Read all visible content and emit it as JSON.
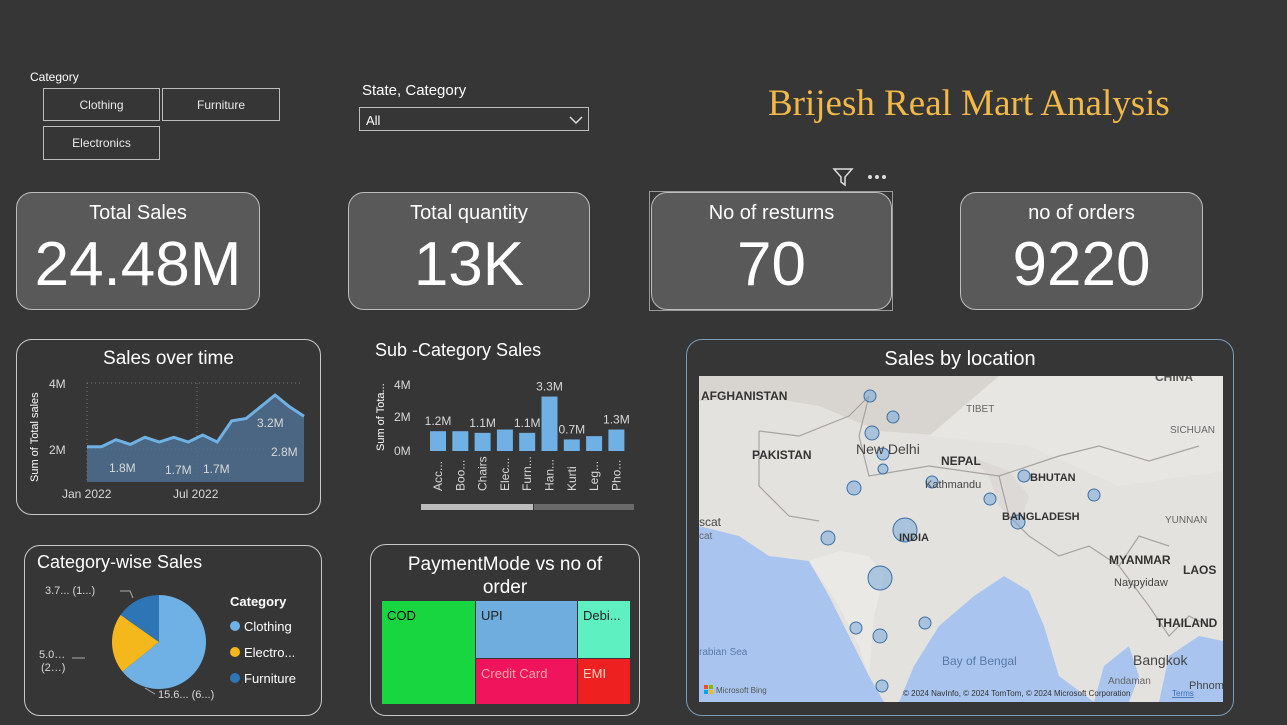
{
  "slicer": {
    "title": "Category",
    "items": [
      "Clothing",
      "Furniture",
      "Electronics"
    ]
  },
  "dropdown": {
    "label": "State, Category",
    "value": "All"
  },
  "title": "Brijesh Real Mart Analysis",
  "kpis": [
    {
      "label": "Total Sales",
      "value": "24.48M"
    },
    {
      "label": "Total quantity",
      "value": "13K"
    },
    {
      "label": "No of resturns",
      "value": "70"
    },
    {
      "label": "no of orders",
      "value": "9220"
    }
  ],
  "colors": {
    "accent_title": "#f2b848",
    "bar": "#6fb1e4",
    "card": "#595959"
  },
  "sales_over_time": {
    "title": "Sales over time",
    "ylabel": "Sum of Total sales",
    "yticks": [
      "4M",
      "2M"
    ],
    "xticks": [
      "Jan 2022",
      "Jul 2022"
    ],
    "data_labels": [
      "1.8M",
      "1.7M",
      "1.7M",
      "3.2M",
      "2.8M"
    ]
  },
  "chart_data": [
    {
      "type": "area",
      "title": "Sales over time",
      "xlabel": "",
      "ylabel": "Sum of Total sales",
      "ylim": [
        0,
        4
      ],
      "unit": "M",
      "x": [
        "2022-01",
        "2022-02",
        "2022-03",
        "2022-04",
        "2022-05",
        "2022-06",
        "2022-07",
        "2022-08",
        "2022-09",
        "2022-10",
        "2022-11",
        "2022-12",
        "2023-01",
        "2023-02",
        "2023-03"
      ],
      "values": [
        1.5,
        1.5,
        1.8,
        1.6,
        1.9,
        1.7,
        1.9,
        1.7,
        2.0,
        1.7,
        2.6,
        2.7,
        3.2,
        3.7,
        3.2,
        2.8
      ]
    },
    {
      "type": "bar",
      "title": "Sub -Category Sales",
      "ylabel": "Sum of Tota...",
      "ylim": [
        0,
        4
      ],
      "unit": "M",
      "categories": [
        "Acc...",
        "Boo...",
        "Chairs",
        "Elec...",
        "Furn...",
        "Han...",
        "Kurti",
        "Leg...",
        "Pho..."
      ],
      "values": [
        1.2,
        1.2,
        1.1,
        1.3,
        1.1,
        3.3,
        0.7,
        0.9,
        1.3
      ],
      "data_labels": [
        "1.2M",
        "",
        "1.1M",
        "",
        "1.1M",
        "3.3M",
        "0.7M",
        "",
        "1.3M"
      ],
      "yticks": [
        "4M",
        "2M",
        "0M"
      ]
    },
    {
      "type": "pie",
      "title": "Category-wise Sales",
      "legend_title": "Category",
      "categories": [
        "Clothing",
        "Electro...",
        "Furniture"
      ],
      "values": [
        15.6,
        5.0,
        3.7
      ],
      "labels": [
        "15.6... (6...)",
        "5.0... (2...)",
        "3.7... (1...)"
      ],
      "colors": [
        "#6fb1e4",
        "#f5b81c",
        "#2e75b6"
      ]
    },
    {
      "type": "table",
      "title": "PaymentMode vs no of order",
      "categories": [
        "COD",
        "UPI",
        "Debi...",
        "Credit Card",
        "EMI"
      ],
      "colors": [
        "#18d640",
        "#6fadde",
        "#5ef0c0",
        "#f0145c",
        "#ee2020"
      ]
    }
  ],
  "map": {
    "title": "Sales by location",
    "labels": [
      "AFGHANISTAN",
      "PAKISTAN",
      "New Delhi",
      "TIBET",
      "NEPAL",
      "Kathmandu",
      "BHUTAN",
      "SICHUAN",
      "BANGLADESH",
      "YUNNAN",
      "INDIA",
      "MYANMAR",
      "Naypyidaw",
      "LAOS",
      "THAILAND",
      "Bay of Bengal",
      "Bangkok",
      "Andaman",
      "Phnom",
      "scat",
      "cat",
      "rabian Sea",
      "CHINA"
    ],
    "bing": "Microsoft Bing",
    "copyright": "© 2024 NavInfo, © 2024 TomTom, © 2024 Microsoft Corporation",
    "terms": "Terms"
  }
}
